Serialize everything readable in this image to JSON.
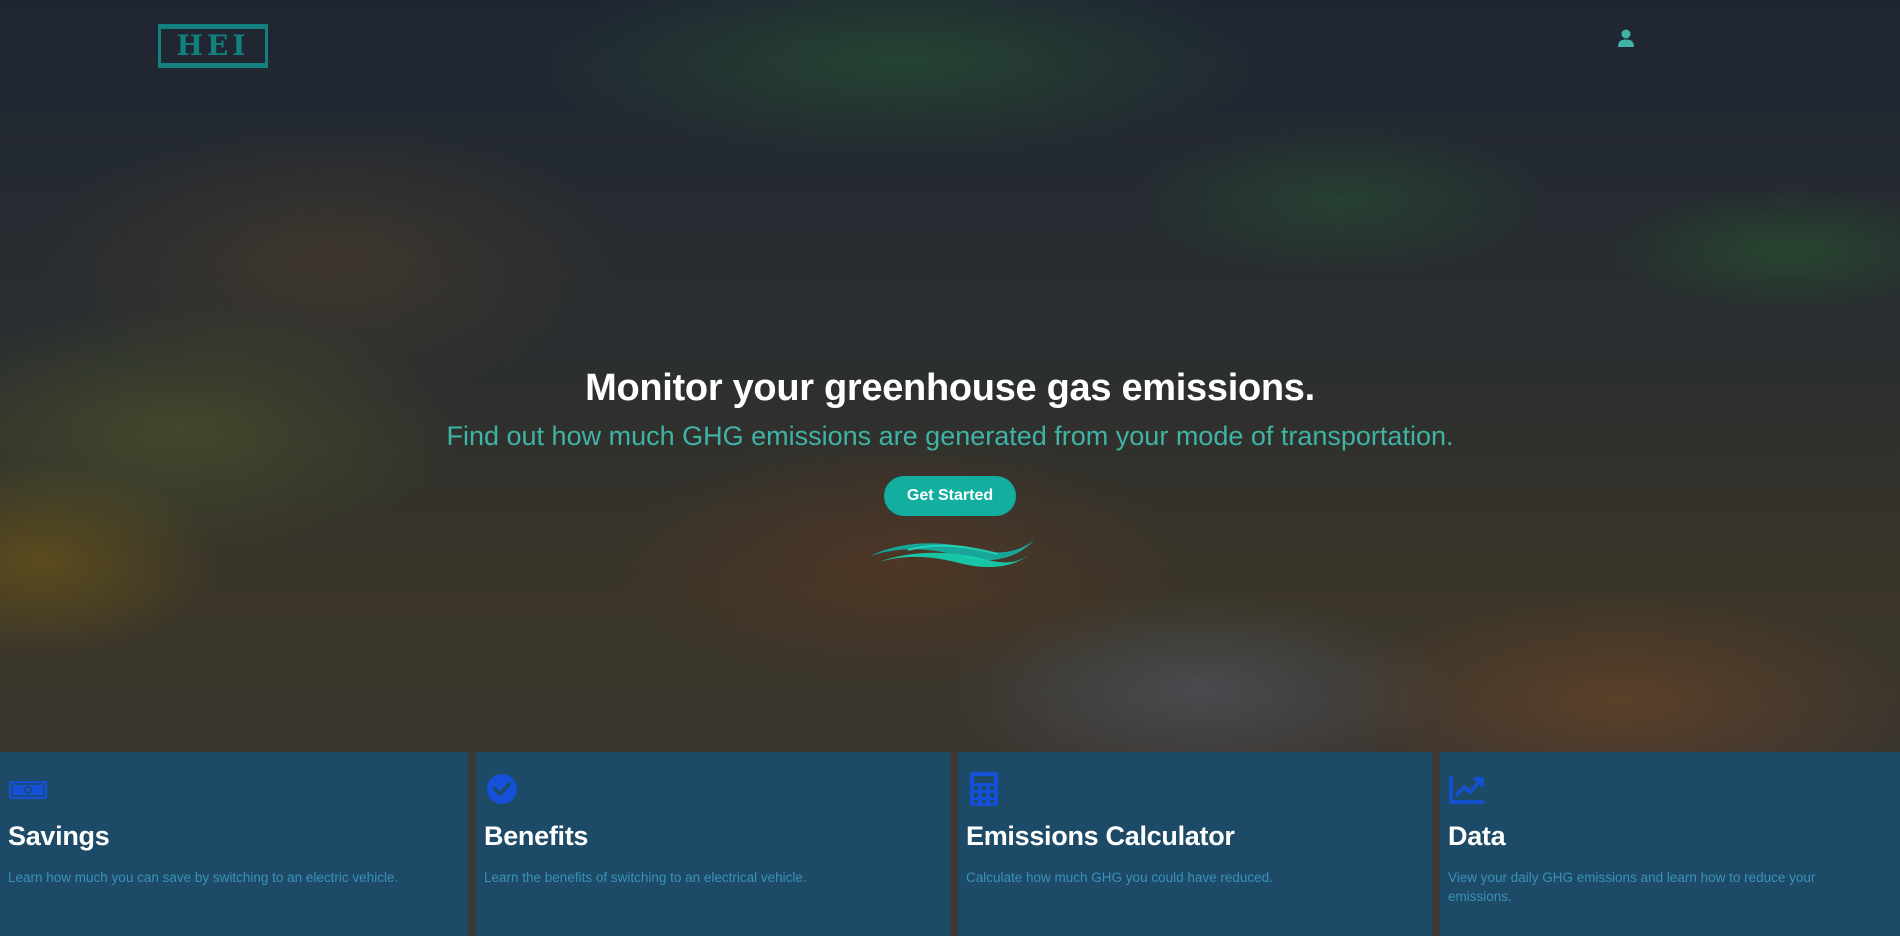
{
  "header": {
    "logo_text": "HEI",
    "user_icon": "user-icon"
  },
  "hero": {
    "title": "Monitor your greenhouse gas emissions.",
    "subtitle": "Find out how much GHG emissions are generated from your mode of transportation.",
    "cta_label": "Get Started"
  },
  "cards": [
    {
      "icon": "money-bill-icon",
      "title": "Savings",
      "description": "Learn how much you can save by switching to an electric vehicle."
    },
    {
      "icon": "check-circle-icon",
      "title": "Benefits",
      "description": "Learn the benefits of switching to an electrical vehicle."
    },
    {
      "icon": "calculator-icon",
      "title": "Emissions Calculator",
      "description": "Calculate how much GHG you could have reduced."
    },
    {
      "icon": "chart-line-icon",
      "title": "Data",
      "description": "View your daily GHG emissions and learn how to reduce your emissions."
    }
  ],
  "colors": {
    "accent": "#12aea0",
    "subtitle": "#3fb3a5",
    "card_bg": "#1d4a66",
    "card_icon": "#1550d8",
    "card_desc": "#3a92b8"
  }
}
